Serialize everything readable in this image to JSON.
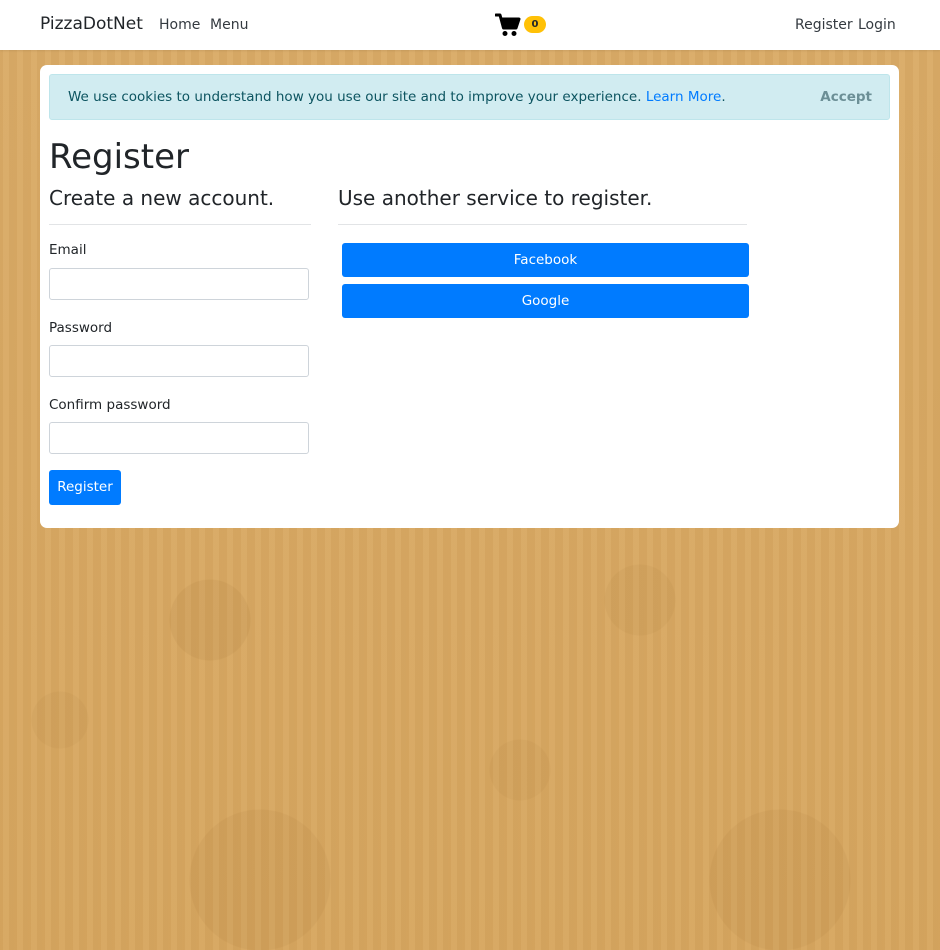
{
  "navbar": {
    "brand": "PizzaDotNet",
    "links": [
      {
        "label": "Home"
      },
      {
        "label": "Menu"
      }
    ],
    "cart_count": "0",
    "right_links": [
      {
        "label": "Register"
      },
      {
        "label": "Login"
      }
    ]
  },
  "cookie_banner": {
    "text": "We use cookies to understand how you use our site and to improve your experience.",
    "link_label": "Learn More",
    "trailing": ".",
    "accept_label": "Accept"
  },
  "page": {
    "title": "Register",
    "left_heading": "Create a new account.",
    "right_heading": "Use another service to register."
  },
  "form": {
    "email_label": "Email",
    "email_value": "",
    "password_label": "Password",
    "password_value": "",
    "confirm_label": "Confirm password",
    "confirm_value": "",
    "submit_label": "Register"
  },
  "external": {
    "providers": [
      {
        "label": "Facebook"
      },
      {
        "label": "Google"
      }
    ]
  },
  "colors": {
    "primary": "#007bff",
    "badge": "#ffc107",
    "alert_bg": "#d1ecf1",
    "background": "#d7a864"
  },
  "icons": {
    "cart": "shopping-cart-icon"
  }
}
